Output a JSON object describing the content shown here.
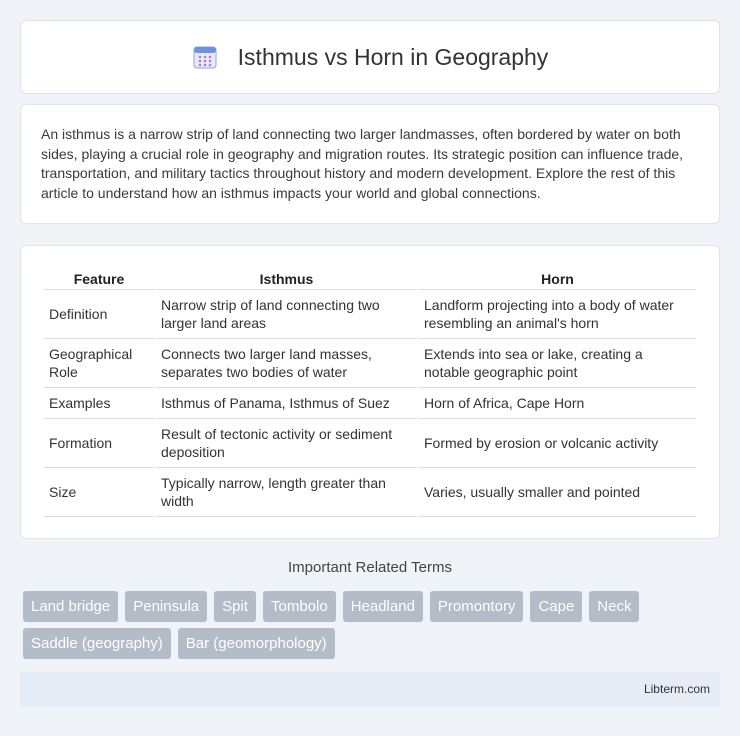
{
  "header": {
    "title": "Isthmus vs Horn in Geography",
    "icon": "calendar-grid-icon"
  },
  "intro": "An isthmus is a narrow strip of land connecting two larger landmasses, often bordered by water on both sides, playing a crucial role in geography and migration routes. Its strategic position can influence trade, transportation, and military tactics throughout history and modern development. Explore the rest of this article to understand how an isthmus impacts your world and global connections.",
  "table": {
    "headers": [
      "Feature",
      "Isthmus",
      "Horn"
    ],
    "rows": [
      [
        "Definition",
        "Narrow strip of land connecting two larger land areas",
        "Landform projecting into a body of water resembling an animal's horn"
      ],
      [
        "Geographical Role",
        "Connects two larger land masses, separates two bodies of water",
        "Extends into sea or lake, creating a notable geographic point"
      ],
      [
        "Examples",
        "Isthmus of Panama, Isthmus of Suez",
        "Horn of Africa, Cape Horn"
      ],
      [
        "Formation",
        "Result of tectonic activity or sediment deposition",
        "Formed by erosion or volcanic activity"
      ],
      [
        "Size",
        "Typically narrow, length greater than width",
        "Varies, usually smaller and pointed"
      ]
    ]
  },
  "related": {
    "title": "Important Related Terms",
    "tags": [
      "Land bridge",
      "Peninsula",
      "Spit",
      "Tombolo",
      "Headland",
      "Promontory",
      "Cape",
      "Neck",
      "Saddle (geography)",
      "Bar (geomorphology)"
    ]
  },
  "footer": "Libterm.com"
}
